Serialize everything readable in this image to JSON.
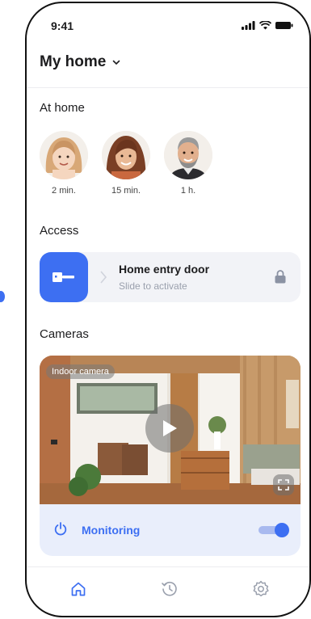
{
  "status_bar": {
    "time": "9:41"
  },
  "header": {
    "title": "My home"
  },
  "at_home": {
    "title": "At home",
    "people": [
      {
        "time": "2 min."
      },
      {
        "time": "15 min."
      },
      {
        "time": "1 h."
      }
    ]
  },
  "access": {
    "title": "Access",
    "door_name": "Home entry door",
    "door_hint": "Slide to activate"
  },
  "cameras": {
    "title": "Cameras",
    "badge": "Indoor camera",
    "monitoring_label": "Monitoring",
    "monitoring_on": true
  },
  "colors": {
    "accent": "#3d6ff2",
    "card_bg": "#f2f3f7",
    "monitor_bg": "#e9eefb"
  },
  "tabs": [
    "home-icon",
    "history-icon",
    "settings-icon"
  ]
}
